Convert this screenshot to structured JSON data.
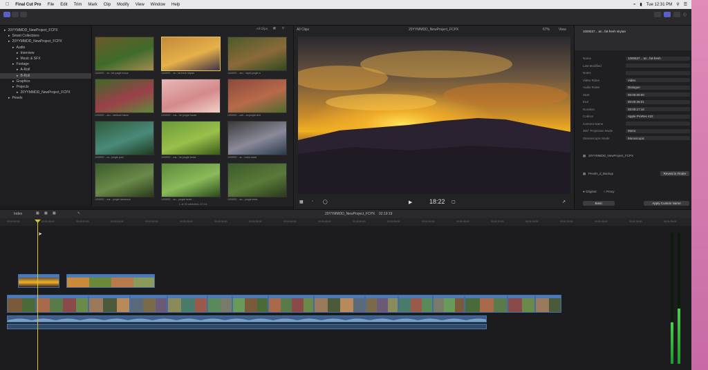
{
  "menubar": {
    "items": [
      "Final Cut Pro",
      "File",
      "Edit",
      "Trim",
      "Mark",
      "Clip",
      "Modify",
      "View",
      "Window",
      "Help"
    ],
    "clock": "Tue 12:31 PM"
  },
  "libraries": {
    "items": [
      {
        "label": "20YYMMDD_NewProject_FCPX",
        "indent": 0
      },
      {
        "label": "Smart Collections",
        "indent": 1
      },
      {
        "label": "20YYMMDD_NewProject_FCPX",
        "indent": 1
      },
      {
        "label": "Audio",
        "indent": 2
      },
      {
        "label": "Interview",
        "indent": 3
      },
      {
        "label": "Music & SFX",
        "indent": 3
      },
      {
        "label": "Footage",
        "indent": 2
      },
      {
        "label": "A-Roll",
        "indent": 3
      },
      {
        "label": "B-Roll",
        "indent": 3,
        "selected": true
      },
      {
        "label": "Graphics",
        "indent": 2
      },
      {
        "label": "Projects",
        "indent": 2
      },
      {
        "label": "20YYMMDD_NewProject_FCPX",
        "indent": 3
      },
      {
        "label": "Pexels",
        "indent": 1
      }
    ]
  },
  "browser": {
    "filter": "All Clips",
    "footer": "1 of 22 selected, 07:14",
    "clips": [
      {
        "label": "1000537... an...fal jungle house",
        "colors": [
          "#6b5a2a",
          "#3f6b2a",
          "#a38c52"
        ]
      },
      {
        "label": "1000537... an...fat-fresh skytan",
        "colors": [
          "#c28a3a",
          "#e6b04a",
          "#3d3246"
        ]
      },
      {
        "label": "1000537... am...  rapid jungle w",
        "colors": [
          "#4d5a2a",
          "#8b6a3a",
          "#2f4a1f"
        ]
      },
      {
        "label": "1000537... am... rainbow hamm",
        "colors": [
          "#3e6a28",
          "#9c3f4a",
          "#5f8a3a"
        ]
      },
      {
        "label": "1000537... ma... fur jungle house",
        "colors": [
          "#e8b8b8",
          "#d48a8a",
          "#f1d0c8"
        ]
      },
      {
        "label": "1000537... cali... an jungle tent",
        "colors": [
          "#8a4a3a",
          "#b86a4a",
          "#4e6a2e"
        ]
      },
      {
        "label": "1000537... ra... jungle pool",
        "colors": [
          "#2f5a3a",
          "#4a8a7a",
          "#1f3a1f"
        ]
      },
      {
        "label": "1000537... ma... fur jungle forest",
        "colors": [
          "#6a9a3a",
          "#9ac04a",
          "#3a5a1a"
        ]
      },
      {
        "label": "1000537... ar... rocks coast",
        "colors": [
          "#3a3a3a",
          "#8a8a9a",
          "#2a3a4a"
        ]
      },
      {
        "label": "1000537... ma... jungle hammock",
        "colors": [
          "#3a5a2a",
          "#6a8a4a",
          "#2a3a1a"
        ]
      },
      {
        "label": "1000537... an... jungle forest",
        "colors": [
          "#5a8a3a",
          "#8aba5a",
          "#2a4a1a"
        ]
      },
      {
        "label": "1000537... an... jungle trees",
        "colors": [
          "#3a5a2a",
          "#5a7a3a",
          "#2a3a1a"
        ]
      }
    ]
  },
  "viewer": {
    "clip_name": "20YYMMDD_NewProject_FCPX",
    "zoom": "67%",
    "view": "View",
    "timecode": "18:22"
  },
  "inspector": {
    "clip_title": "1000537... an...fat-fresh skytan",
    "rows": [
      {
        "label": "Name",
        "value": "1000537... an...fat-fresh"
      },
      {
        "label": "Last Modified",
        "value": ""
      },
      {
        "label": "Notes",
        "value": ""
      },
      {
        "label": "Video Roles",
        "value": "Video"
      },
      {
        "label": "Audio Roles",
        "value": "Dialogue"
      },
      {
        "label": "Start",
        "value": "00:00:00:00"
      },
      {
        "label": "End",
        "value": "00:00:26:01"
      },
      {
        "label": "Duration",
        "value": "00:00:17:18"
      },
      {
        "label": "Codecs",
        "value": "Apple ProRes 422"
      },
      {
        "label": "Camera Name",
        "value": ""
      },
      {
        "label": "360° Projection Mode",
        "value": "Mono"
      },
      {
        "label": "Stereoscopic Mode",
        "value": "Monoscopic"
      }
    ],
    "location_label": "20YYMMDD_NewProject_FCPX",
    "library_label": "Pexels_d_Backup",
    "reveal_button": "Reveal in Finder",
    "media_options": [
      "Original",
      "Proxy"
    ],
    "basic_button": "Basic",
    "apply_button": "Apply Custom Name"
  },
  "timeline": {
    "index_label": "Index",
    "project_name": "20YYMMDD_NewProject_FCPX",
    "duration": "02:19:19",
    "ruler_ticks": [
      "00:00:00:00",
      "00:00:05:00",
      "00:00:10:00",
      "00:00:15:00",
      "00:00:20:00",
      "00:00:25:00",
      "00:00:30:00",
      "00:00:35:00",
      "00:00:40:00",
      "00:00:45:00",
      "00:00:50:00",
      "00:00:55:00",
      "00:01:00:00",
      "00:01:05:00",
      "00:01:10:00",
      "00:01:15:00",
      "00:01:20:00",
      "00:01:25:00",
      "00:01:30:00",
      "00:01:35:00"
    ]
  }
}
